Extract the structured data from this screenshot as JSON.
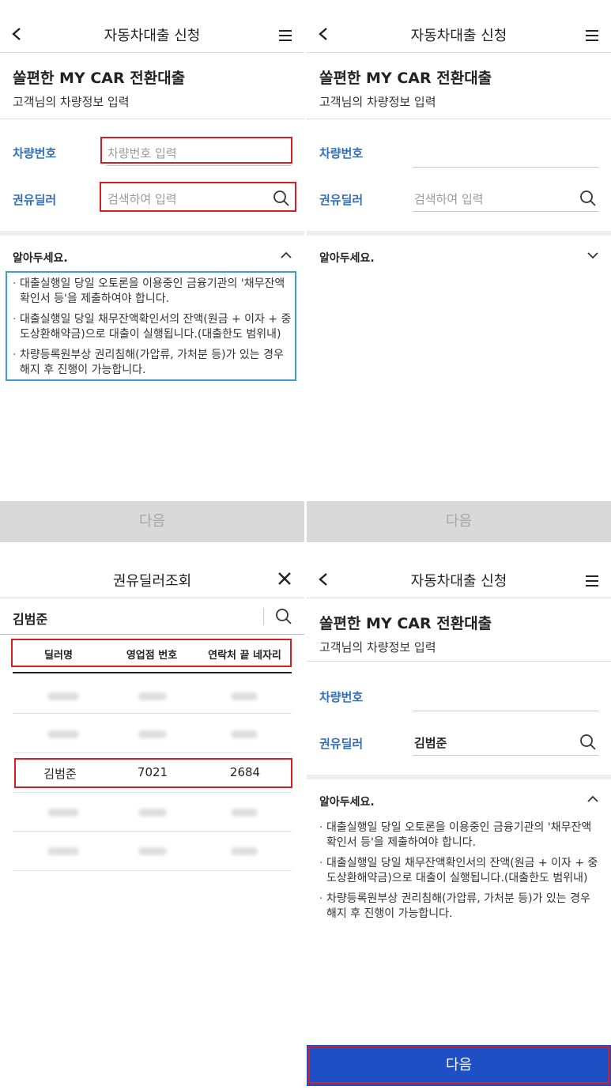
{
  "common": {
    "header_title": "자동차대출 신청",
    "product_title": "쏠편한 MY CAR 전환대출",
    "subtitle": "고객님의 차량정보 입력",
    "car_number_label": "차량번호",
    "car_number_placeholder": "차량번호 입력",
    "dealer_label": "권유딜러",
    "dealer_placeholder": "검색하여 입력",
    "notice_title": "알아두세요.",
    "notices": [
      "대출실행일 당일 오토론을 이용중인 금융기관의 '채무잔액확인서 등'을 제출하여야 합니다.",
      "대출실행일 당일 채무잔액확인서의 잔액(원금 + 이자 + 중도상환해약금)으로 대출이 실행됩니다.(대출한도 범위내)",
      "차량등록원부상 권리침해(가압류, 가처분 등)가 있는 경우 해지 후 진행이 가능합니다."
    ],
    "next_label": "다음"
  },
  "dealer_search": {
    "title": "권유딜러조회",
    "query": "김범준",
    "columns": [
      "딜러명",
      "영업점 번호",
      "연락처 끝 네자리"
    ],
    "result": {
      "name": "김범준",
      "branch": "7021",
      "phone_last4": "2684"
    }
  },
  "completed": {
    "dealer_value": "김범준"
  },
  "colors": {
    "label_blue": "#2f6fb4",
    "highlight_red": "#d21f26",
    "highlight_blue": "#3a9ed4",
    "button_active": "#1e4fc4",
    "button_disabled": "#d9d9d9"
  }
}
